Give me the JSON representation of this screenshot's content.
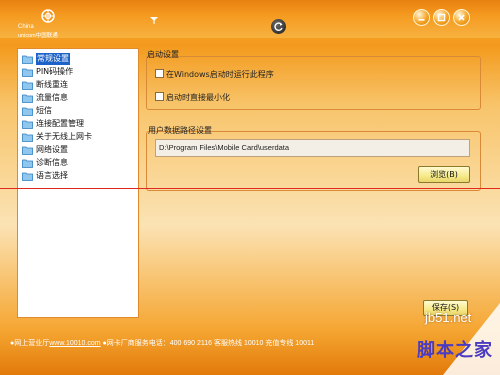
{
  "header": {
    "brand_line1": "China",
    "brand_line2": "unicom中国联通",
    "signal_icon": "signal-icon",
    "refresh_icon": "refresh-icon",
    "window_buttons": [
      "minimize-icon",
      "maximize-icon",
      "close-icon"
    ]
  },
  "sidebar": {
    "items": [
      {
        "label": "常规设置",
        "active": true
      },
      {
        "label": "PIN码操作",
        "active": false
      },
      {
        "label": "断线重连",
        "active": false
      },
      {
        "label": "流量信息",
        "active": false
      },
      {
        "label": "短信",
        "active": false
      },
      {
        "label": "连接配置管理",
        "active": false
      },
      {
        "label": "关于无线上网卡",
        "active": false
      },
      {
        "label": "网络设置",
        "active": false
      },
      {
        "label": "诊断信息",
        "active": false
      },
      {
        "label": "语言选择",
        "active": false
      }
    ]
  },
  "startup": {
    "title": "启动设置",
    "option1": {
      "label": "在Windows启动时运行此程序",
      "checked": false
    },
    "option2": {
      "label": "启动时直接最小化",
      "checked": false
    }
  },
  "data_path": {
    "title": "用户数据路径设置",
    "value": "D:\\Program Files\\Mobile Card\\userdata",
    "browse_label": "浏览(B)"
  },
  "save_label": "保存(S)",
  "footer": {
    "prefix": "●网上营业厅",
    "link": "www.10010.com",
    "rest": " ●网卡厂商服务电话：400 690 2116   客服热线 10010   充值专线 10011"
  },
  "watermark": {
    "line1": "jb51.net",
    "line2": "脚本之家"
  },
  "colors": {
    "accent": "#f39a1c",
    "selection": "#1c62c8",
    "group_border": "#d98a36",
    "indicator_line": "#e0281e"
  }
}
